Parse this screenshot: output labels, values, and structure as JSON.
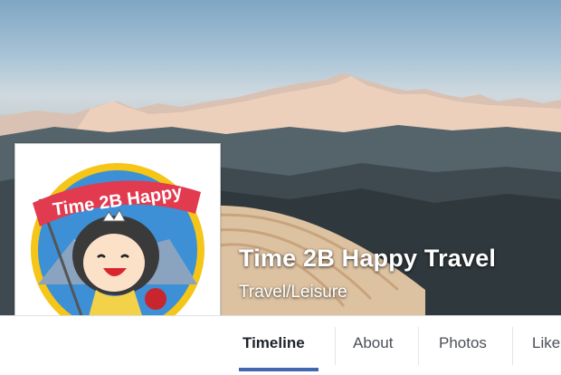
{
  "page": {
    "name": "Time 2B Happy Travel",
    "category": "Travel/Leisure"
  },
  "logo": {
    "banner_text": "Time 2B Happy"
  },
  "nav": {
    "tabs": [
      {
        "label": "Timeline",
        "active": true
      },
      {
        "label": "About",
        "active": false
      },
      {
        "label": "Photos",
        "active": false
      },
      {
        "label": "Like",
        "active": false
      }
    ]
  },
  "colors": {
    "accent": "#4267b2",
    "logo_banner": "#e23a4e",
    "logo_ring": "#f5c518",
    "logo_sky": "#3d8fd6"
  }
}
